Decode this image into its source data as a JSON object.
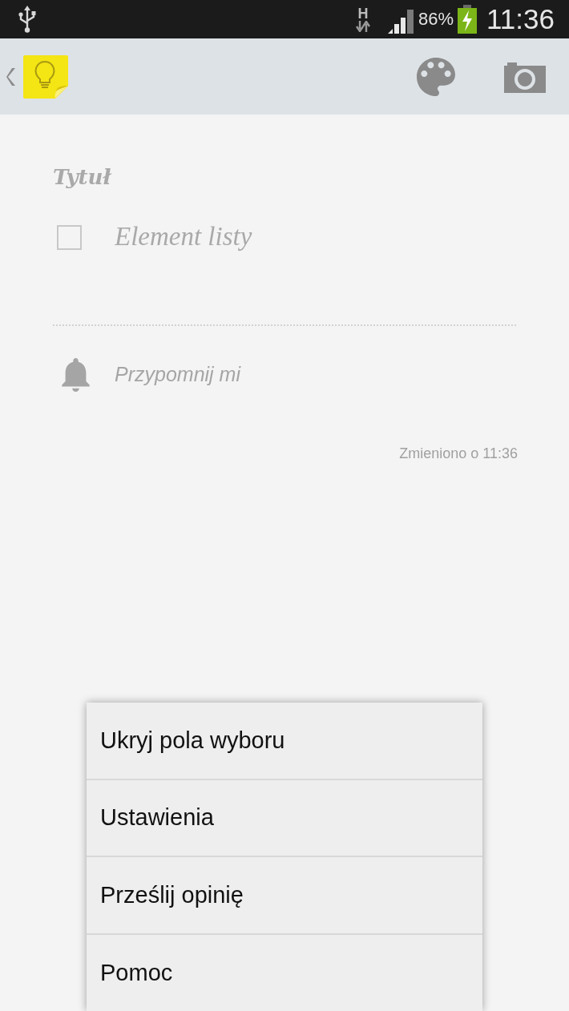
{
  "status_bar": {
    "network_type": "H",
    "battery": "86%",
    "time": "11:36"
  },
  "note": {
    "title": {
      "placeholder": "Tytuł"
    },
    "list_items": [
      {
        "placeholder": "Element listy",
        "checked": false
      }
    ],
    "reminder": {
      "label": "Przypomnij mi"
    },
    "modified": "Zmieniono o 11:36"
  },
  "menu": {
    "items": [
      {
        "label": "Ukryj pola wyboru"
      },
      {
        "label": "Ustawienia"
      },
      {
        "label": "Prześlij opinię"
      },
      {
        "label": "Pomoc"
      }
    ]
  }
}
